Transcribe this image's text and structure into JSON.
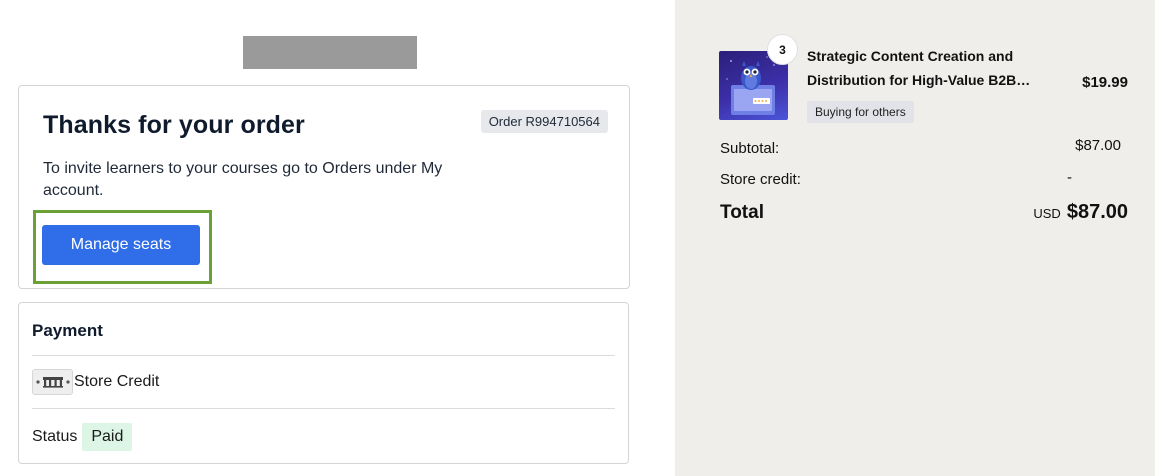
{
  "thanks": {
    "title": "Thanks for your order",
    "order_badge": "Order R994710564",
    "invite_text": "To invite learners to your courses go to Orders under My account.",
    "manage_button": "Manage seats"
  },
  "payment": {
    "title": "Payment",
    "method_icon": "store-credit-icon",
    "method_label": "Store Credit",
    "status_label": "Status",
    "status_value": "Paid"
  },
  "summary": {
    "product": {
      "quantity": "3",
      "title": "Strategic Content Creation and Distribution for High-Value B2B…",
      "badge": "Buying for others",
      "price": "$19.99"
    },
    "subtotal_label": "Subtotal:",
    "subtotal_value": "$87.00",
    "store_credit_label": "Store credit:",
    "store_credit_value": "-",
    "total_label": "Total",
    "total_currency": "USD",
    "total_value": "$87.00"
  },
  "colors": {
    "primary_button": "#2f6ee8",
    "highlight_outline": "#6aa134",
    "paid_badge": "#dcf5e5",
    "summary_background": "#efeeea"
  }
}
